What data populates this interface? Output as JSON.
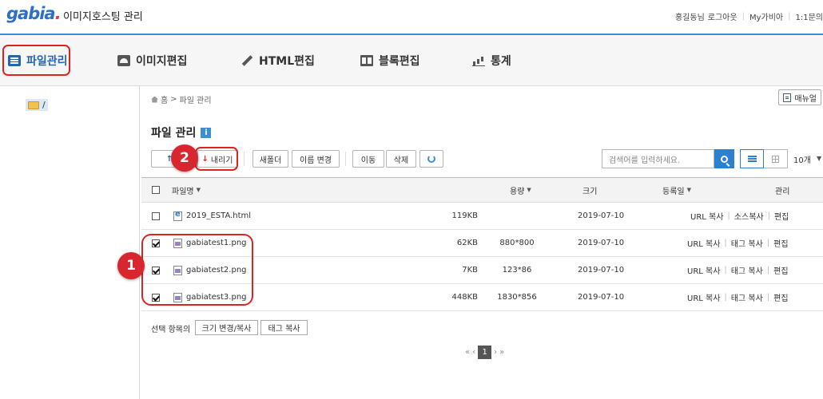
{
  "header": {
    "logo": "gabia",
    "logo_dot": ".",
    "title": "이미지호스팅 관리",
    "user": "홍길동님",
    "logout": "로그아웃",
    "my": "My가비아",
    "inquiry": "1:1문의"
  },
  "nav": {
    "items": [
      {
        "label": "파일관리",
        "icon": "list-icon",
        "active": true
      },
      {
        "label": "이미지편집",
        "icon": "image-icon"
      },
      {
        "label": "HTML편집",
        "icon": "pen-icon"
      },
      {
        "label": "블록편집",
        "icon": "block-icon"
      },
      {
        "label": "통계",
        "icon": "stats-icon"
      }
    ]
  },
  "sidebar": {
    "root_label": "/"
  },
  "breadcrumb": {
    "home": "홈",
    "sep": ">",
    "current": "파일 관리"
  },
  "manual_label": "매뉴얼",
  "page_title": "파일 관리",
  "info_label": "i",
  "toolbar": {
    "upload": "올",
    "download": "내리기",
    "new_folder": "새폴더",
    "rename": "이름 변경",
    "move": "이동",
    "delete": "삭제"
  },
  "search": {
    "placeholder": "검색어를 입력하세요."
  },
  "per_page": "10개",
  "table": {
    "headers": {
      "name": "파일명",
      "capacity": "용량",
      "size": "크기",
      "date": "등록일",
      "manage": "관리"
    },
    "rows": [
      {
        "name": "2019_ESTA.html",
        "type": "html",
        "capacity": "119KB",
        "size": "",
        "date": "2019-07-10",
        "action1": "URL 복사",
        "action2": "소스복사",
        "action3": "편집",
        "checked": false
      },
      {
        "name": "gabiatest1.png",
        "type": "png",
        "capacity": "62KB",
        "size": "880*800",
        "date": "2019-07-10",
        "action1": "URL 복사",
        "action2": "태그 복사",
        "action3": "편집",
        "checked": true
      },
      {
        "name": "gabiatest2.png",
        "type": "png",
        "capacity": "7KB",
        "size": "123*86",
        "date": "2019-07-10",
        "action1": "URL 복사",
        "action2": "태그 복사",
        "action3": "편집",
        "checked": true
      },
      {
        "name": "gabiatest3.png",
        "type": "png",
        "capacity": "448KB",
        "size": "1830*856",
        "date": "2019-07-10",
        "action1": "URL 복사",
        "action2": "태그 복사",
        "action3": "편집",
        "checked": true
      }
    ]
  },
  "selection": {
    "label": "선택 항목의",
    "resize_copy": "크기 변경/복사",
    "tag_copy": "태그 복사"
  },
  "pager": {
    "first": "«",
    "prev": "‹",
    "current": "1",
    "next": "›",
    "last": "»"
  },
  "annotations": {
    "badge1": "1",
    "badge2": "2"
  },
  "colors": {
    "accent": "#2166b0",
    "highlight": "#d8262f",
    "search_button": "#2c80d0"
  }
}
